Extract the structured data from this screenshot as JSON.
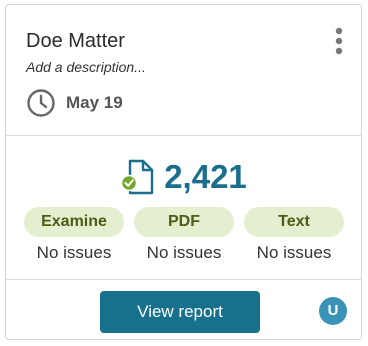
{
  "matter": {
    "title": "Doe Matter",
    "description_placeholder": "Add a description...",
    "date": "May 19"
  },
  "summary": {
    "document_count": "2,421"
  },
  "checks": [
    {
      "label": "Examine",
      "status": "No issues"
    },
    {
      "label": "PDF",
      "status": "No issues"
    },
    {
      "label": "Text",
      "status": "No issues"
    }
  ],
  "actions": {
    "view_report_label": "View report"
  },
  "user": {
    "avatar_initial": "U"
  },
  "icons": {
    "menu": "more-vertical-icon",
    "date": "clock-icon",
    "documents": "document-check-icon"
  },
  "colors": {
    "accent": "#17718c",
    "count": "#1b6f8c",
    "pill_bg": "#e3efce",
    "pill_text": "#4b5d17",
    "check_badge": "#74a82c",
    "avatar_bg": "#3a92b6"
  }
}
